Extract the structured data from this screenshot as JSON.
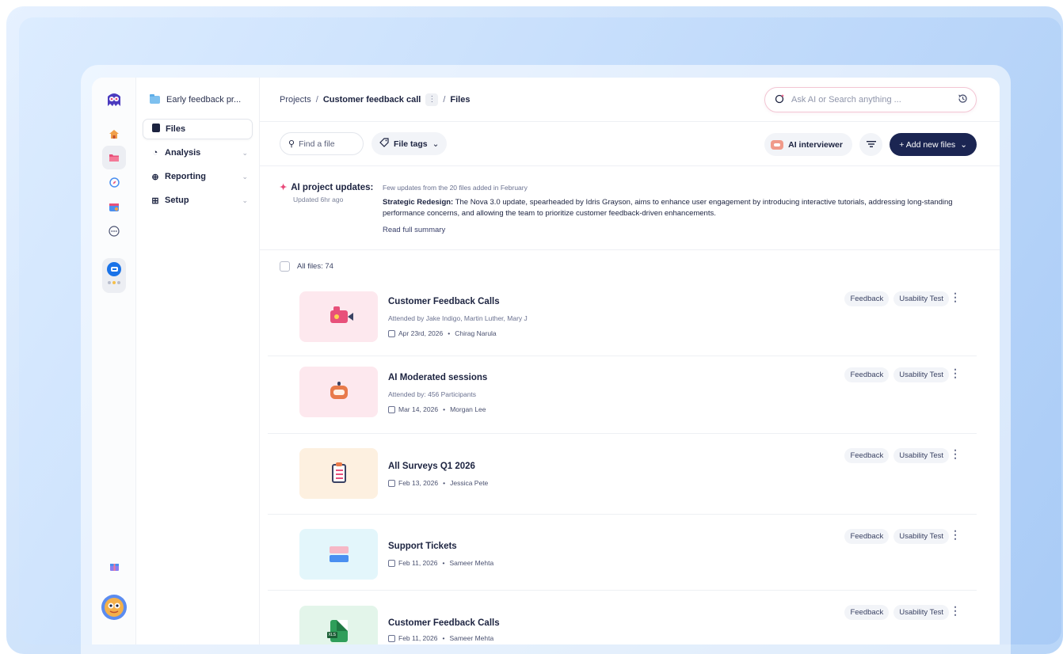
{
  "nav": {
    "project_name": "Early feedback pr...",
    "items": [
      {
        "label": "Files"
      },
      {
        "label": "Analysis"
      },
      {
        "label": "Reporting"
      },
      {
        "label": "Setup"
      }
    ]
  },
  "breadcrumb": {
    "projects": "Projects",
    "sep": "/",
    "call": "Customer feedback call",
    "more": "⋮",
    "files": "Files"
  },
  "search": {
    "placeholder": "Ask AI or Search anything ..."
  },
  "toolbar": {
    "find_placeholder": "Find a file",
    "file_tags": "File tags",
    "ai_interviewer": "AI interviewer",
    "add_new_files": "+ Add new files"
  },
  "updates": {
    "title": "AI project updates:",
    "updated": "Updated 6hr ago",
    "meta": "Few updates from the 20 files added in February",
    "body_bold": "Strategic Redesign:",
    "body": " The Nova 3.0 update, spearheaded by Idris Grayson, aims to enhance user engagement by introducing interactive tutorials, addressing long-standing performance concerns, and allowing the team to prioritize customer feedback-driven enhancements.",
    "link": "Read full summary"
  },
  "all_files": "All files: 74",
  "files": [
    {
      "title": "Customer Feedback Calls",
      "attended": "Attended by Jake Indigo, Martin Luther,  Mary J",
      "date": "Apr 23rd, 2026",
      "owner": "Chirag Narula",
      "tags": [
        "Feedback",
        "Usability Test"
      ]
    },
    {
      "title": "AI Moderated sessions",
      "attended": "Attended by: 456 Participants",
      "date": "Mar 14, 2026",
      "owner": "Morgan Lee",
      "tags": [
        "Feedback",
        "Usability Test"
      ]
    },
    {
      "title": "All Surveys Q1 2026",
      "attended": "",
      "date": "Feb 13, 2026",
      "owner": "Jessica Pete",
      "tags": [
        "Feedback",
        "Usability Test"
      ]
    },
    {
      "title": "Support Tickets",
      "attended": "",
      "date": "Feb 11, 2026",
      "owner": "Sameer Mehta",
      "tags": [
        "Feedback",
        "Usability Test"
      ]
    },
    {
      "title": "Customer Feedback Calls",
      "attended": "",
      "date": "Feb 11, 2026",
      "owner": "Sameer Mehta",
      "tags": [
        "Feedback",
        "Usability Test"
      ]
    }
  ],
  "xls_label": "XLS",
  "colors": {
    "primary": "#1b2552",
    "accent_pink": "#e8507a",
    "thumb_pink": "#fde8ee",
    "thumb_peach": "#fdf0e0",
    "thumb_cyan": "#e3f6fb",
    "thumb_green": "#e3f5ea"
  }
}
